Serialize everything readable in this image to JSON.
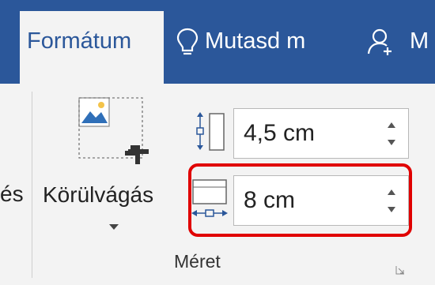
{
  "ribbon_tabs": {
    "format": "Formátum",
    "tell_me": "Mutasd m",
    "share_partial": "M"
  },
  "ribbon": {
    "left_partial_label": "és",
    "crop_label": "Körülvágás",
    "height_value": "4,5 cm",
    "width_value": "8 cm",
    "size_group_label": "Méret"
  },
  "colors": {
    "accent": "#2b579a",
    "highlight": "#e00000"
  },
  "icons": [
    "lightbulb-icon",
    "person-add-icon",
    "crop-icon",
    "height-icon",
    "width-icon",
    "spin-up-icon",
    "spin-down-icon",
    "dialog-launcher-icon"
  ]
}
